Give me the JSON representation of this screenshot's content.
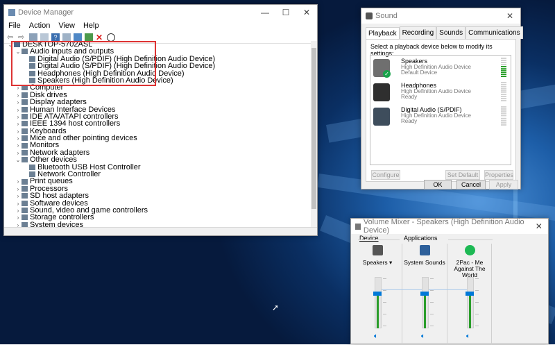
{
  "device_manager": {
    "title": "Device Manager",
    "menu": [
      "File",
      "Action",
      "View",
      "Help"
    ],
    "tree": [
      {
        "text": "DESKTOP-5702ASL",
        "indent": 0,
        "arrow": "⌄"
      },
      {
        "text": "Audio inputs and outputs",
        "indent": 1,
        "arrow": "⌄"
      },
      {
        "text": "Digital Audio (S/PDIF) (High Definition Audio Device)",
        "indent": 2,
        "arrow": ""
      },
      {
        "text": "Digital Audio (S/PDIF) (High Definition Audio Device)",
        "indent": 2,
        "arrow": ""
      },
      {
        "text": "Headphones (High Definition Audio Device)",
        "indent": 2,
        "arrow": ""
      },
      {
        "text": "Speakers (High Definition Audio Device)",
        "indent": 2,
        "arrow": ""
      },
      {
        "text": "Computer",
        "indent": 1,
        "arrow": "›"
      },
      {
        "text": "Disk drives",
        "indent": 1,
        "arrow": "›"
      },
      {
        "text": "Display adapters",
        "indent": 1,
        "arrow": "›"
      },
      {
        "text": "Human Interface Devices",
        "indent": 1,
        "arrow": "›"
      },
      {
        "text": "IDE ATA/ATAPI controllers",
        "indent": 1,
        "arrow": "›"
      },
      {
        "text": "IEEE 1394 host controllers",
        "indent": 1,
        "arrow": "›"
      },
      {
        "text": "Keyboards",
        "indent": 1,
        "arrow": "›"
      },
      {
        "text": "Mice and other pointing devices",
        "indent": 1,
        "arrow": "›"
      },
      {
        "text": "Monitors",
        "indent": 1,
        "arrow": "›"
      },
      {
        "text": "Network adapters",
        "indent": 1,
        "arrow": "›"
      },
      {
        "text": "Other devices",
        "indent": 1,
        "arrow": "⌄"
      },
      {
        "text": "Bluetooth USB Host Controller",
        "indent": 2,
        "arrow": ""
      },
      {
        "text": "Network Controller",
        "indent": 2,
        "arrow": ""
      },
      {
        "text": "Print queues",
        "indent": 1,
        "arrow": "›"
      },
      {
        "text": "Processors",
        "indent": 1,
        "arrow": "›"
      },
      {
        "text": "SD host adapters",
        "indent": 1,
        "arrow": "›"
      },
      {
        "text": "Software devices",
        "indent": 1,
        "arrow": "›"
      },
      {
        "text": "Sound, video and game controllers",
        "indent": 1,
        "arrow": "›"
      },
      {
        "text": "Storage controllers",
        "indent": 1,
        "arrow": "›"
      },
      {
        "text": "System devices",
        "indent": 1,
        "arrow": "›"
      }
    ]
  },
  "sound": {
    "title": "Sound",
    "tabs": [
      "Playback",
      "Recording",
      "Sounds",
      "Communications"
    ],
    "hint": "Select a playback device below to modify its settings:",
    "devices": [
      {
        "name": "Speakers",
        "desc": "High Definition Audio Device",
        "status": "Default Device",
        "default": true,
        "level": 0.55
      },
      {
        "name": "Headphones",
        "desc": "High Definition Audio Device",
        "status": "Ready",
        "default": false,
        "level": 0
      },
      {
        "name": "Digital Audio (S/PDIF)",
        "desc": "High Definition Audio Device",
        "status": "Ready",
        "default": false,
        "level": 0
      }
    ],
    "buttons": {
      "configure": "Configure",
      "set_default": "Set Default",
      "properties": "Properties",
      "ok": "OK",
      "cancel": "Cancel",
      "apply": "Apply"
    }
  },
  "volume_mixer": {
    "title": "Volume Mixer - Speakers (High Definition Audio Device)",
    "device_group": "Device",
    "applications_group": "Applications",
    "columns": [
      {
        "label": "Speakers",
        "dropdown": true,
        "level": 0.72
      },
      {
        "label": "System Sounds",
        "dropdown": false,
        "level": 0.72
      },
      {
        "label": "2Pac - Me Against The World",
        "dropdown": false,
        "level": 0.72
      }
    ]
  },
  "colors": {
    "accent": "#0078d7",
    "highlight_box": "#dd3333",
    "spotify_green": "#1db954",
    "level_green": "#2a9d2a"
  }
}
